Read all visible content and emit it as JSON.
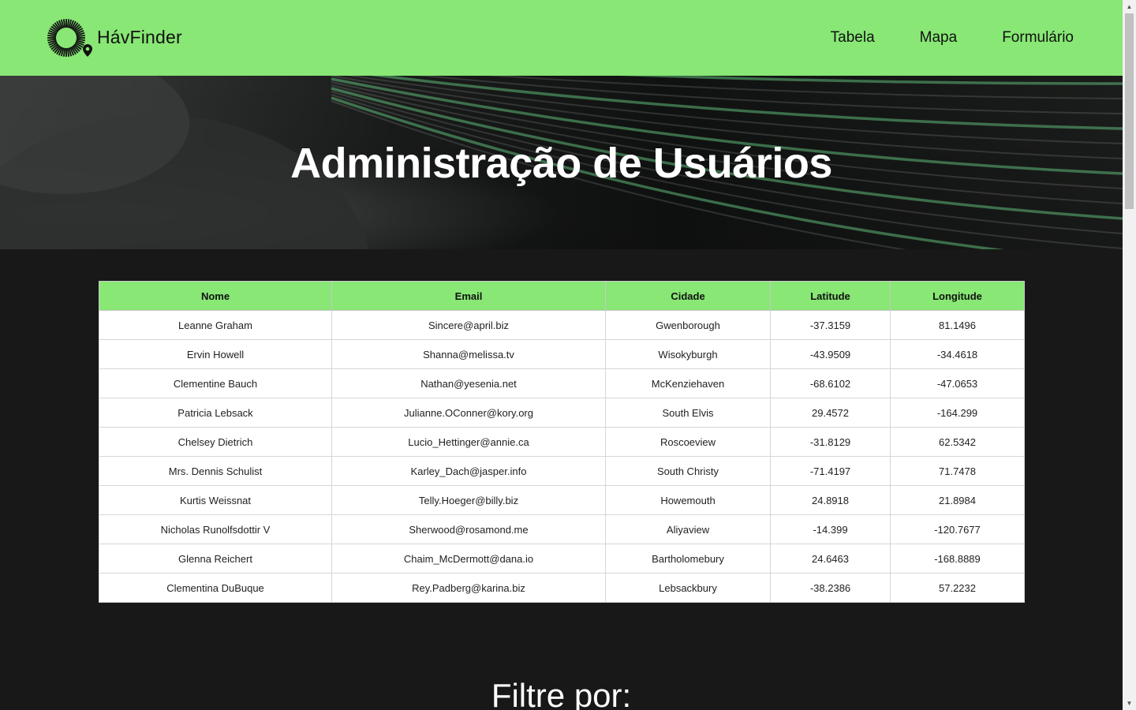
{
  "header": {
    "brand": "HávFinder",
    "nav": [
      {
        "label": "Tabela"
      },
      {
        "label": "Mapa"
      },
      {
        "label": "Formulário"
      }
    ]
  },
  "hero": {
    "title": "Administração de Usuários"
  },
  "table": {
    "columns": [
      "Nome",
      "Email",
      "Cidade",
      "Latitude",
      "Longitude"
    ],
    "rows": [
      [
        "Leanne Graham",
        "Sincere@april.biz",
        "Gwenborough",
        "-37.3159",
        "81.1496"
      ],
      [
        "Ervin Howell",
        "Shanna@melissa.tv",
        "Wisokyburgh",
        "-43.9509",
        "-34.4618"
      ],
      [
        "Clementine Bauch",
        "Nathan@yesenia.net",
        "McKenziehaven",
        "-68.6102",
        "-47.0653"
      ],
      [
        "Patricia Lebsack",
        "Julianne.OConner@kory.org",
        "South Elvis",
        "29.4572",
        "-164.299"
      ],
      [
        "Chelsey Dietrich",
        "Lucio_Hettinger@annie.ca",
        "Roscoeview",
        "-31.8129",
        "62.5342"
      ],
      [
        "Mrs. Dennis Schulist",
        "Karley_Dach@jasper.info",
        "South Christy",
        "-71.4197",
        "71.7478"
      ],
      [
        "Kurtis Weissnat",
        "Telly.Hoeger@billy.biz",
        "Howemouth",
        "24.8918",
        "21.8984"
      ],
      [
        "Nicholas Runolfsdottir V",
        "Sherwood@rosamond.me",
        "Aliyaview",
        "-14.399",
        "-120.7677"
      ],
      [
        "Glenna Reichert",
        "Chaim_McDermott@dana.io",
        "Bartholomebury",
        "24.6463",
        "-168.8889"
      ],
      [
        "Clementina DuBuque",
        "Rey.Padberg@karina.biz",
        "Lebsackbury",
        "-38.2386",
        "57.2232"
      ]
    ]
  },
  "filter": {
    "title": "Filtre por:"
  },
  "colors": {
    "accent": "#88e775",
    "background": "#181818"
  },
  "icons": {
    "logo": "sunburst-location-pin-icon",
    "scroll_up": "triangle-up-icon",
    "scroll_down": "triangle-down-icon"
  }
}
